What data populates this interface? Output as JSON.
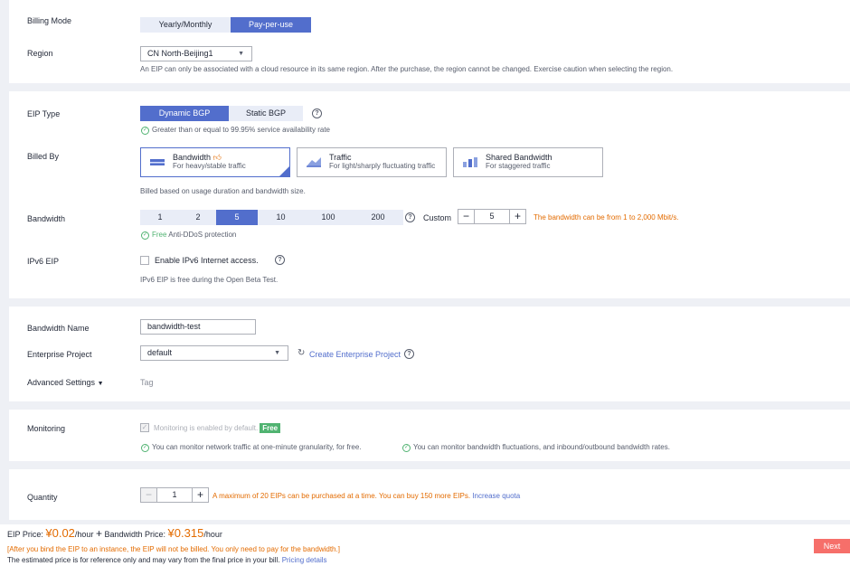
{
  "basic": {
    "billing_mode_label": "Billing Mode",
    "billing_modes": [
      "Yearly/Monthly",
      "Pay-per-use"
    ],
    "billing_mode_selected": "Pay-per-use",
    "region_label": "Region",
    "region_value": "CN North-Beijing1",
    "region_note": "An EIP can only be associated with a cloud resource in its same region. After the purchase, the region cannot be changed. Exercise caution when selecting the region."
  },
  "eip": {
    "type_label": "EIP Type",
    "types": [
      "Dynamic BGP",
      "Static BGP"
    ],
    "type_selected": "Dynamic BGP",
    "type_note": "Greater than or equal to 99.95% service availability rate",
    "billed_by_label": "Billed By",
    "billed_by_options": [
      {
        "title": "Bandwidth",
        "sub": "For heavy/stable traffic"
      },
      {
        "title": "Traffic",
        "sub": "For light/sharply fluctuating traffic"
      },
      {
        "title": "Shared Bandwidth",
        "sub": "For staggered traffic"
      }
    ],
    "billed_by_selected": "Bandwidth",
    "billed_by_note": "Billed based on usage duration and bandwidth size.",
    "bandwidth_label": "Bandwidth",
    "bandwidth_options": [
      "1",
      "2",
      "5",
      "10",
      "100",
      "200"
    ],
    "bandwidth_selected": "5",
    "custom_label": "Custom",
    "custom_value": "5",
    "bandwidth_range_note": "The bandwidth can be from 1 to 2,000 Mbit/s.",
    "ddos_free": "Free",
    "ddos_text": "Anti-DDoS protection",
    "ipv6_label": "IPv6 EIP",
    "ipv6_checkbox_label": "Enable IPv6 Internet access.",
    "ipv6_checked": false,
    "ipv6_note": "IPv6 EIP is free during the Open Beta Test."
  },
  "naming": {
    "bandwidth_name_label": "Bandwidth Name",
    "bandwidth_name_value": "bandwidth-test",
    "enterprise_project_label": "Enterprise Project",
    "enterprise_project_value": "default",
    "create_project_link": "Create Enterprise Project",
    "advanced_label": "Advanced Settings",
    "tag_label": "Tag"
  },
  "monitoring": {
    "label": "Monitoring",
    "checkbox_text": "Monitoring is enabled by default.",
    "free_badge": "Free",
    "note_1": "You can monitor network traffic at one-minute granularity, for free.",
    "note_2": "You can monitor bandwidth fluctuations, and inbound/outbound bandwidth rates."
  },
  "quantity": {
    "label": "Quantity",
    "value": "1",
    "limit_note": "A maximum of 20 EIPs can be purchased at a time.",
    "remaining_note": "You can buy 150 more EIPs.",
    "increase_link": "Increase quota"
  },
  "footer": {
    "eip_price_label": "EIP Price:",
    "eip_price_value": "¥0.02",
    "eip_price_unit": "/hour",
    "plus": "+",
    "bw_price_label": "Bandwidth Price:",
    "bw_price_value": "¥0.315",
    "bw_price_unit": "/hour",
    "warning": "[After you bind the EIP to an instance, the EIP will not be billed. You only need to pay for the bandwidth.]",
    "estimate_note": "The estimated price is for reference only and may vary from the final price in your bill.",
    "pricing_link": "Pricing details",
    "next_label": "Next"
  },
  "colors": {
    "accent": "#526ecc",
    "warning": "#e36b00",
    "success": "#50b371",
    "next_button": "#f66f6a"
  },
  "icons": {
    "help": "help-circle-icon",
    "check": "check-circle-icon",
    "like": "thumbs-up-icon",
    "caret": "chevron-down-icon",
    "refresh": "refresh-icon"
  }
}
